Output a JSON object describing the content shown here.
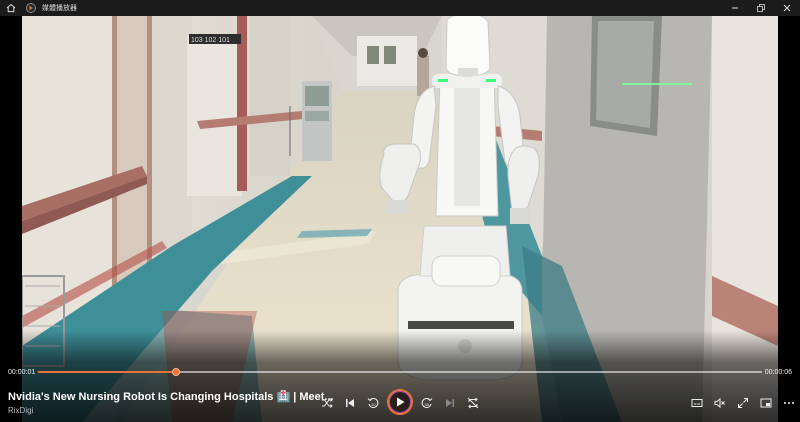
{
  "window": {
    "title": "媒體播放器",
    "icons": [
      "home-icon",
      "app-icon",
      "minimize-icon",
      "maximize-icon",
      "close-icon"
    ]
  },
  "player": {
    "current_time": "00:00:01",
    "duration": "00:00:06",
    "progress": 0.19,
    "video_title": "Nvidia's New Nursing Robot Is Changing Hospitals 🏥 | Meet...",
    "channel": "RixDigi",
    "accent_color": "#e8733a"
  },
  "scene": {
    "door_sign": "103 102 101"
  },
  "controls": {
    "icons": [
      "shuffle-icon",
      "previous-icon",
      "rewind-10-icon",
      "play-icon",
      "forward-30-icon",
      "next-icon",
      "repeat-off-icon",
      "captions-icon",
      "volume-mute-icon",
      "fullscreen-icon",
      "mini-player-icon",
      "more-icon"
    ]
  }
}
